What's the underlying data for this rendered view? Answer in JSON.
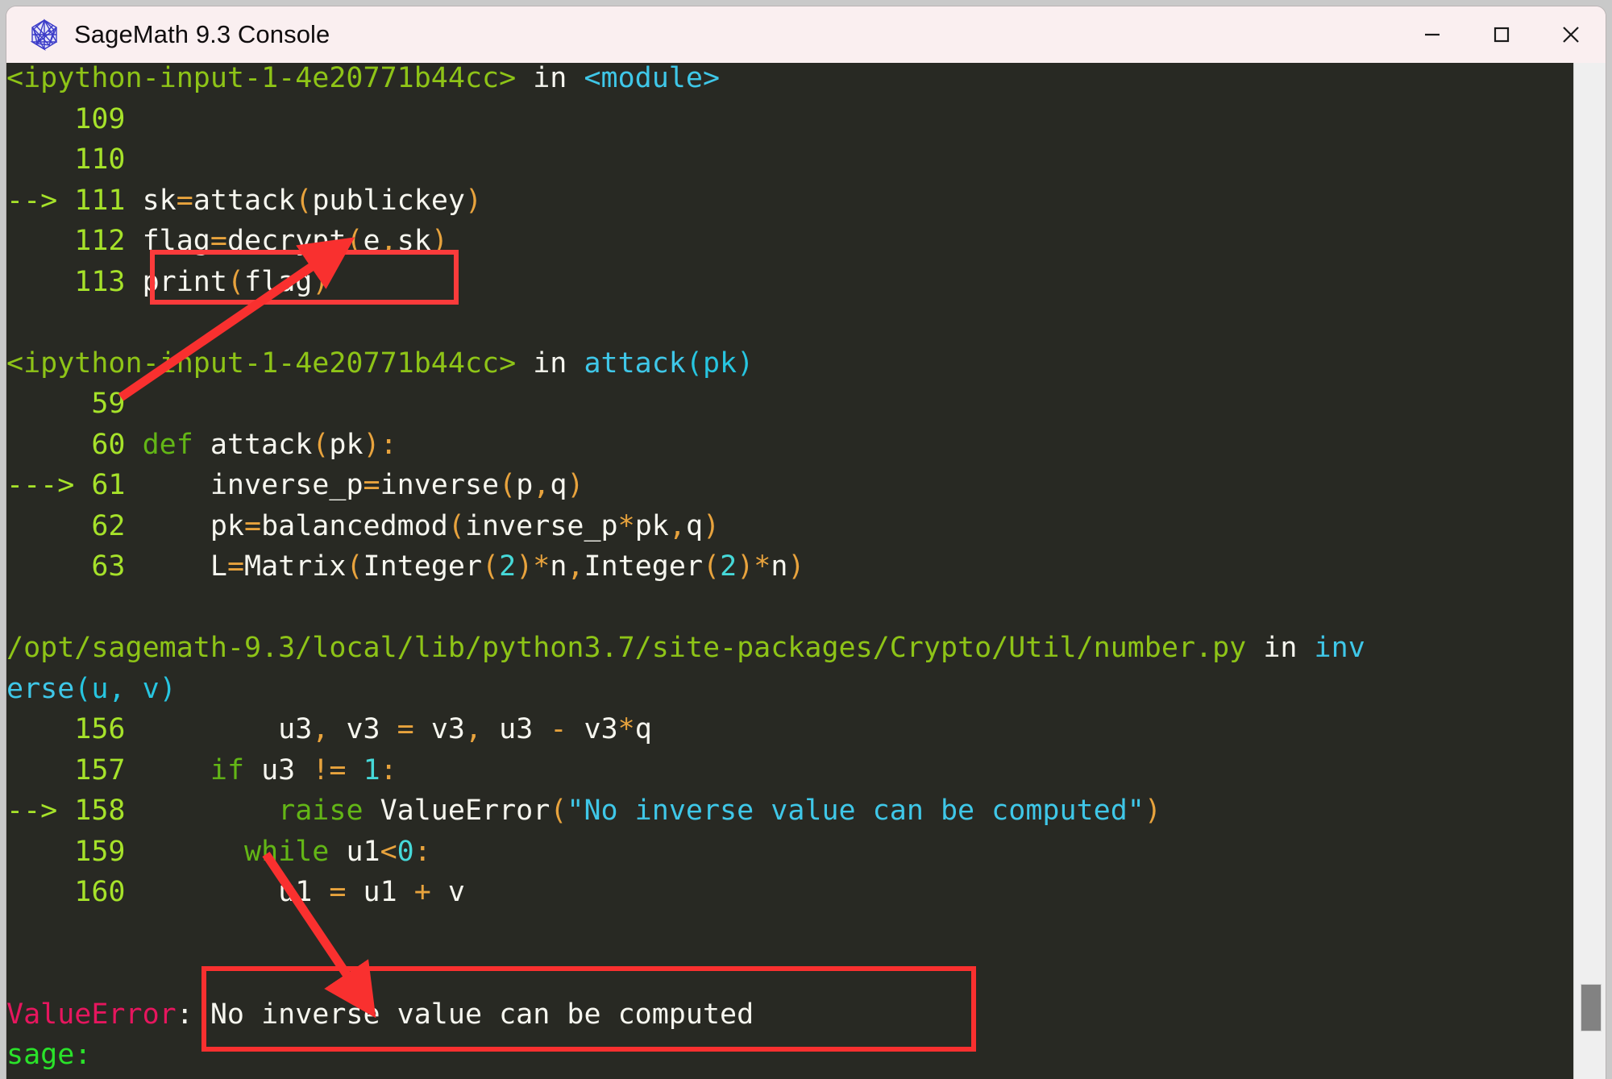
{
  "window": {
    "title": "SageMath 9.3 Console",
    "icon": "sagemath-polyhedron-icon",
    "buttons": {
      "minimize": "minimize-button",
      "maximize": "maximize-button",
      "close": "close-button"
    }
  },
  "colors": {
    "titlebar_bg": "#faeff0",
    "terminal_bg": "#282923",
    "annotation_red": "#fb3b3b",
    "traceback_green": "#8ec417",
    "lineno_green": "#a6e22a",
    "keyword_green": "#63b616",
    "string_cyan": "#3fc7e8",
    "operator_orange": "#e8a33d",
    "number_cyan": "#46d9d9",
    "error_magenta": "#e6165e",
    "prompt_green": "#2ae22a",
    "text_white": "#f6f6ef",
    "scrollbar_track": "#efefef",
    "scrollbar_thumb": "#828282"
  },
  "terminal": {
    "lines": [
      {
        "id": "frame-1-header",
        "tokens": [
          {
            "t": "<ipython-input-1-4e20771b44cc>",
            "c": "c-green"
          },
          {
            "t": " in ",
            "c": "c-white"
          },
          {
            "t": "<module>",
            "c": "c-cyan"
          }
        ]
      },
      {
        "id": "code-109",
        "tokens": [
          {
            "t": "    109 ",
            "c": "c-lgreen"
          }
        ]
      },
      {
        "id": "code-110",
        "tokens": [
          {
            "t": "    110 ",
            "c": "c-lgreen"
          }
        ]
      },
      {
        "id": "code-111",
        "tokens": [
          {
            "t": "--> 111 ",
            "c": "c-lgreen"
          },
          {
            "t": "sk",
            "c": "c-white"
          },
          {
            "t": "=",
            "c": "c-orange"
          },
          {
            "t": "attack",
            "c": "c-white"
          },
          {
            "t": "(",
            "c": "c-orange"
          },
          {
            "t": "publickey",
            "c": "c-white"
          },
          {
            "t": ")",
            "c": "c-orange"
          }
        ]
      },
      {
        "id": "code-112",
        "tokens": [
          {
            "t": "    112 ",
            "c": "c-lgreen"
          },
          {
            "t": "flag",
            "c": "c-white"
          },
          {
            "t": "=",
            "c": "c-orange"
          },
          {
            "t": "decrypt",
            "c": "c-white"
          },
          {
            "t": "(",
            "c": "c-orange"
          },
          {
            "t": "e",
            "c": "c-white"
          },
          {
            "t": ",",
            "c": "c-orange"
          },
          {
            "t": "sk",
            "c": "c-white"
          },
          {
            "t": ")",
            "c": "c-orange"
          }
        ]
      },
      {
        "id": "code-113",
        "tokens": [
          {
            "t": "    113 ",
            "c": "c-lgreen"
          },
          {
            "t": "print",
            "c": "c-white"
          },
          {
            "t": "(",
            "c": "c-orange"
          },
          {
            "t": "flag",
            "c": "c-white"
          },
          {
            "t": ")",
            "c": "c-orange"
          }
        ]
      },
      {
        "id": "blank-1",
        "tokens": [
          {
            "t": " ",
            "c": "c-white"
          }
        ]
      },
      {
        "id": "frame-2-header",
        "tokens": [
          {
            "t": "<ipython-input-1-4e20771b44cc>",
            "c": "c-green"
          },
          {
            "t": " in ",
            "c": "c-white"
          },
          {
            "t": "attack",
            "c": "c-cyan"
          },
          {
            "t": "(pk)",
            "c": "c-cyan2"
          }
        ]
      },
      {
        "id": "code-59",
        "tokens": [
          {
            "t": "     59 ",
            "c": "c-lgreen"
          }
        ]
      },
      {
        "id": "code-60",
        "tokens": [
          {
            "t": "     60 ",
            "c": "c-lgreen"
          },
          {
            "t": "def ",
            "c": "c-keyword"
          },
          {
            "t": "attack",
            "c": "c-white"
          },
          {
            "t": "(",
            "c": "c-orange"
          },
          {
            "t": "pk",
            "c": "c-white"
          },
          {
            "t": "):",
            "c": "c-orange"
          }
        ]
      },
      {
        "id": "code-61",
        "tokens": [
          {
            "t": "---> 61 ",
            "c": "c-lgreen"
          },
          {
            "t": "    inverse_p",
            "c": "c-white"
          },
          {
            "t": "=",
            "c": "c-orange"
          },
          {
            "t": "inverse",
            "c": "c-white"
          },
          {
            "t": "(",
            "c": "c-orange"
          },
          {
            "t": "p",
            "c": "c-white"
          },
          {
            "t": ",",
            "c": "c-orange"
          },
          {
            "t": "q",
            "c": "c-white"
          },
          {
            "t": ")",
            "c": "c-orange"
          }
        ]
      },
      {
        "id": "code-62",
        "tokens": [
          {
            "t": "     62 ",
            "c": "c-lgreen"
          },
          {
            "t": "    pk",
            "c": "c-white"
          },
          {
            "t": "=",
            "c": "c-orange"
          },
          {
            "t": "balancedmod",
            "c": "c-white"
          },
          {
            "t": "(",
            "c": "c-orange"
          },
          {
            "t": "inverse_p",
            "c": "c-white"
          },
          {
            "t": "*",
            "c": "c-orange"
          },
          {
            "t": "pk",
            "c": "c-white"
          },
          {
            "t": ",",
            "c": "c-orange"
          },
          {
            "t": "q",
            "c": "c-white"
          },
          {
            "t": ")",
            "c": "c-orange"
          }
        ]
      },
      {
        "id": "code-63",
        "tokens": [
          {
            "t": "     63 ",
            "c": "c-lgreen"
          },
          {
            "t": "    L",
            "c": "c-white"
          },
          {
            "t": "=",
            "c": "c-orange"
          },
          {
            "t": "Matrix",
            "c": "c-white"
          },
          {
            "t": "(",
            "c": "c-orange"
          },
          {
            "t": "Integer",
            "c": "c-white"
          },
          {
            "t": "(",
            "c": "c-orange"
          },
          {
            "t": "2",
            "c": "c-num"
          },
          {
            "t": ")",
            "c": "c-orange"
          },
          {
            "t": "*",
            "c": "c-orange"
          },
          {
            "t": "n",
            "c": "c-white"
          },
          {
            "t": ",",
            "c": "c-orange"
          },
          {
            "t": "Integer",
            "c": "c-white"
          },
          {
            "t": "(",
            "c": "c-orange"
          },
          {
            "t": "2",
            "c": "c-num"
          },
          {
            "t": ")",
            "c": "c-orange"
          },
          {
            "t": "*",
            "c": "c-orange"
          },
          {
            "t": "n",
            "c": "c-white"
          },
          {
            "t": ")",
            "c": "c-orange"
          }
        ]
      },
      {
        "id": "blank-2",
        "tokens": [
          {
            "t": " ",
            "c": "c-white"
          }
        ]
      },
      {
        "id": "frame-3-header",
        "tokens": [
          {
            "t": "/opt/sagemath-9.3/local/lib/python3.7/site-packages/Crypto/Util/number.py",
            "c": "c-green"
          },
          {
            "t": " in ",
            "c": "c-white"
          },
          {
            "t": "inv",
            "c": "c-cyan"
          }
        ]
      },
      {
        "id": "frame-3-header-wrap",
        "tokens": [
          {
            "t": "erse",
            "c": "c-cyan"
          },
          {
            "t": "(u, v)",
            "c": "c-cyan2"
          }
        ]
      },
      {
        "id": "code-156",
        "tokens": [
          {
            "t": "    156 ",
            "c": "c-lgreen"
          },
          {
            "t": "        u3",
            "c": "c-white"
          },
          {
            "t": ",",
            "c": "c-orange"
          },
          {
            "t": " v3 ",
            "c": "c-white"
          },
          {
            "t": "=",
            "c": "c-orange"
          },
          {
            "t": " v3",
            "c": "c-white"
          },
          {
            "t": ",",
            "c": "c-orange"
          },
          {
            "t": " u3 ",
            "c": "c-white"
          },
          {
            "t": "-",
            "c": "c-orange"
          },
          {
            "t": " v3",
            "c": "c-white"
          },
          {
            "t": "*",
            "c": "c-orange"
          },
          {
            "t": "q",
            "c": "c-white"
          }
        ]
      },
      {
        "id": "code-157",
        "tokens": [
          {
            "t": "    157 ",
            "c": "c-lgreen"
          },
          {
            "t": "    ",
            "c": "c-white"
          },
          {
            "t": "if",
            "c": "c-keyword"
          },
          {
            "t": " u3 ",
            "c": "c-white"
          },
          {
            "t": "!=",
            "c": "c-orange"
          },
          {
            "t": " ",
            "c": "c-white"
          },
          {
            "t": "1",
            "c": "c-num"
          },
          {
            "t": ":",
            "c": "c-orange"
          }
        ]
      },
      {
        "id": "code-158",
        "tokens": [
          {
            "t": "--> 158 ",
            "c": "c-lgreen"
          },
          {
            "t": "        ",
            "c": "c-white"
          },
          {
            "t": "raise",
            "c": "c-keyword"
          },
          {
            "t": " ValueError",
            "c": "c-white"
          },
          {
            "t": "(",
            "c": "c-orange"
          },
          {
            "t": "\"No inverse value can be computed\"",
            "c": "c-cyan"
          },
          {
            "t": ")",
            "c": "c-orange"
          }
        ]
      },
      {
        "id": "code-159",
        "tokens": [
          {
            "t": "    159 ",
            "c": "c-lgreen"
          },
          {
            "t": "      ",
            "c": "c-white"
          },
          {
            "t": "while",
            "c": "c-keyword"
          },
          {
            "t": " u1",
            "c": "c-white"
          },
          {
            "t": "<",
            "c": "c-orange"
          },
          {
            "t": "0",
            "c": "c-num"
          },
          {
            "t": ":",
            "c": "c-orange"
          }
        ]
      },
      {
        "id": "code-160",
        "tokens": [
          {
            "t": "    160 ",
            "c": "c-lgreen"
          },
          {
            "t": "        u1 ",
            "c": "c-white"
          },
          {
            "t": "=",
            "c": "c-orange"
          },
          {
            "t": " u1 ",
            "c": "c-white"
          },
          {
            "t": "+",
            "c": "c-orange"
          },
          {
            "t": " v",
            "c": "c-white"
          }
        ]
      },
      {
        "id": "blank-3",
        "tokens": [
          {
            "t": " ",
            "c": "c-white"
          }
        ]
      },
      {
        "id": "blank-4",
        "tokens": [
          {
            "t": " ",
            "c": "c-white"
          }
        ]
      },
      {
        "id": "error-line",
        "tokens": [
          {
            "t": "ValueError",
            "c": "c-err"
          },
          {
            "t": ": No inverse value can be computed",
            "c": "c-white"
          }
        ]
      },
      {
        "id": "prompt-line",
        "tokens": [
          {
            "t": "sage:",
            "c": "c-prompt"
          }
        ]
      }
    ]
  },
  "annotations": {
    "rect_line111": "highlight-rectangle-line-111",
    "rect_error": "highlight-rectangle-error-message",
    "arrow_to_line111": "annotation-arrow-to-line-111",
    "arrow_to_error": "annotation-arrow-to-error-message"
  },
  "scrollbar": {
    "name": "vertical-scrollbar",
    "thumb": "scrollbar-thumb"
  }
}
